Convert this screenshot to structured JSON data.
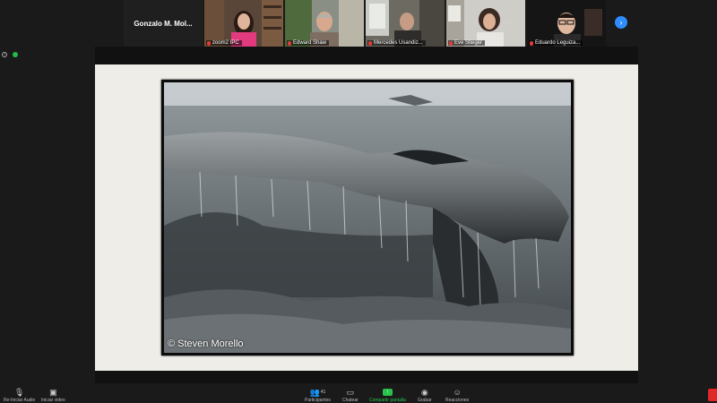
{
  "participants": [
    {
      "name": "Gonzalo M. Mol..."
    },
    {
      "name": "zoom2 IPC"
    },
    {
      "name": "Edward Shaw"
    },
    {
      "name": "Mercedes Usandiz..."
    },
    {
      "name": "Eve Stieger"
    },
    {
      "name": "Eduardo Leguiza..."
    }
  ],
  "slide": {
    "credit": "© Steven Morello"
  },
  "toolbar": {
    "audio_label": "Re-Iniciar Audio",
    "video_label": "Iniciar video",
    "participants_label": "Participantes",
    "participants_count": "41",
    "chat_label": "Chatear",
    "share_label": "Compartir pantalla",
    "record_label": "Grabar",
    "reactions_label": "Reacciones"
  },
  "colors": {
    "share_green": "#27c24c",
    "accent_blue": "#2d8cff",
    "end_red": "#e02828"
  }
}
